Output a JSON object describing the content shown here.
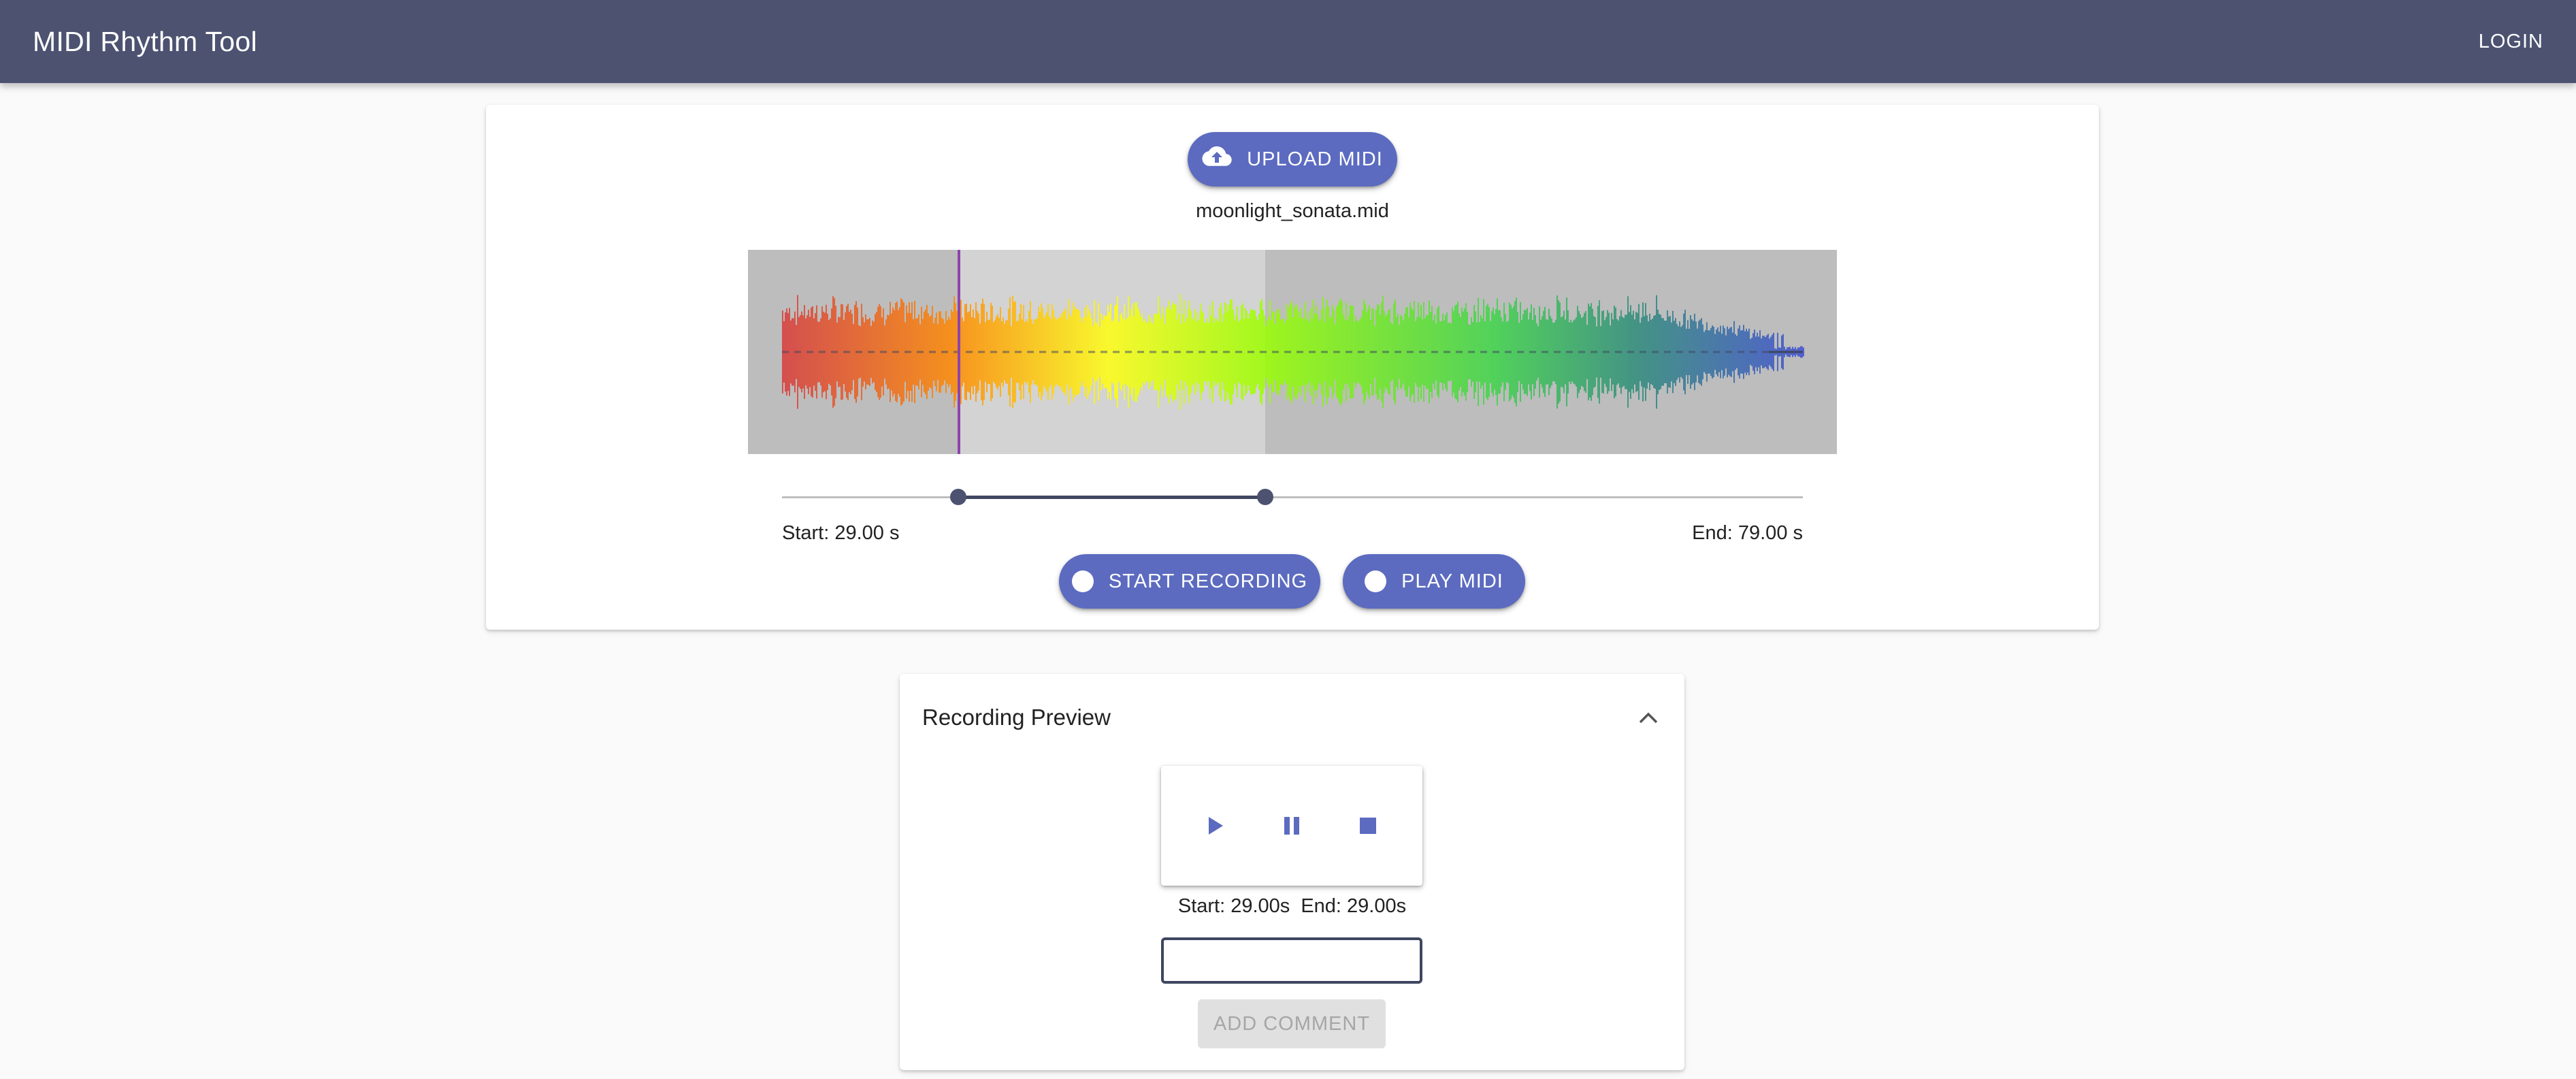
{
  "app": {
    "title": "MIDI Rhythm Tool",
    "login_label": "LOGIN"
  },
  "upload": {
    "label": "UPLOAD MIDI",
    "icon": "cloud-upload-icon",
    "file_name": "moonlight_sonata.mid"
  },
  "waveform": {
    "gradient": [
      "#d94040",
      "#ff8c00",
      "#ffff00",
      "#aaff00",
      "#40d040",
      "#2e8b7a",
      "#3f51d0"
    ],
    "selection_background": "#d3d3d3",
    "background": "#bdbdbd",
    "cursor_color": "#8e44ad"
  },
  "range": {
    "start_label": "Start: 29.00 s",
    "end_label": "End: 79.00 s",
    "start_fraction": 0.173,
    "end_fraction": 0.473
  },
  "actions": {
    "record_label": "START RECORDING",
    "play_label": "PLAY MIDI"
  },
  "preview": {
    "title": "Recording Preview",
    "start_text": "Start: 29.00s",
    "end_text": "End: 29.00s",
    "comment_value": "",
    "add_comment_label": "ADD COMMENT"
  },
  "colors": {
    "appbar": "#4c5270",
    "accent": "#5c6bc0"
  }
}
